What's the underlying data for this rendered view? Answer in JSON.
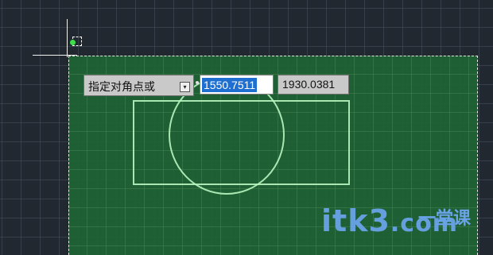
{
  "prompt": {
    "label": "指定对角点或",
    "dropdown_icon": "dropdown-arrow-icon"
  },
  "inputs": {
    "x_value": "1550.7511",
    "y_value": "1930.0381"
  },
  "watermark": {
    "text": "itk3",
    "sub_text": "一堂课",
    "domain_text": ".com"
  },
  "colors": {
    "canvas_bg": "#212830",
    "selection_fill": "#1e6434",
    "shape_stroke": "#b8f5c0",
    "highlight": "#1f6fd0",
    "watermark": "#6aa3e8"
  }
}
